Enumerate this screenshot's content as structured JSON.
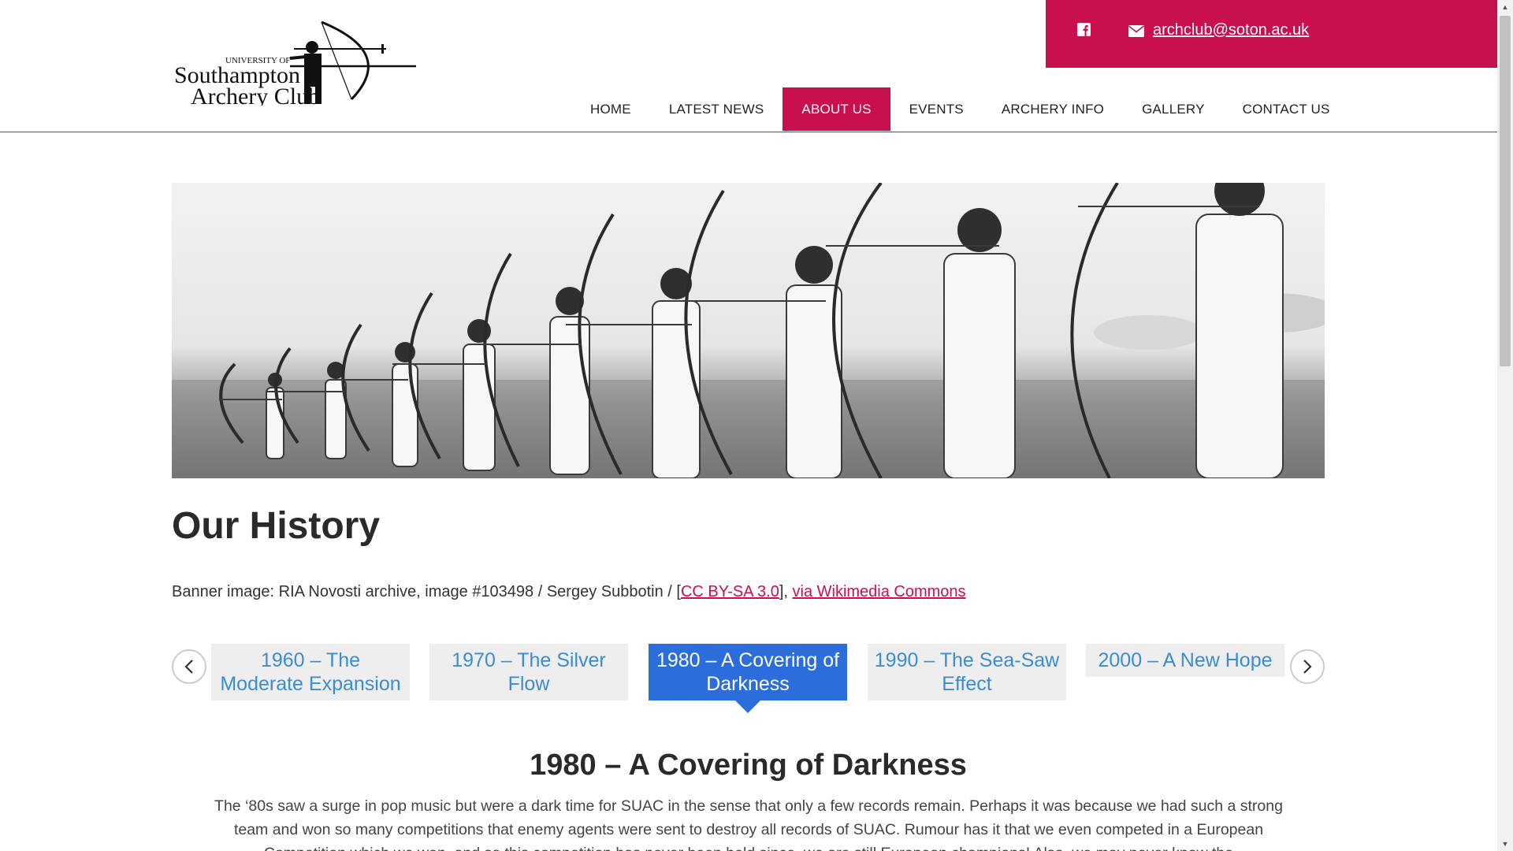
{
  "header": {
    "logo": {
      "line1": "UNIVERSITY OF",
      "line2": "Southampton",
      "line3": "Archery Club"
    },
    "contact": {
      "facebook_icon": "facebook-icon",
      "mail_icon": "envelope-icon",
      "email": "archclub@soton.ac.uk"
    },
    "nav": [
      {
        "label": "HOME",
        "active": false
      },
      {
        "label": "LATEST NEWS",
        "active": false
      },
      {
        "label": "ABOUT US",
        "active": true
      },
      {
        "label": "EVENTS",
        "active": false
      },
      {
        "label": "ARCHERY INFO",
        "active": false
      },
      {
        "label": "GALLERY",
        "active": false
      },
      {
        "label": "CONTACT US",
        "active": false
      }
    ]
  },
  "page": {
    "title": "Our History",
    "credit_prefix": "Banner image: RIA Novosti archive, image #103498 / Sergey Subbotin / [",
    "credit_link1": "CC BY-SA 3.0",
    "credit_mid": "], ",
    "credit_link2": "via Wikimedia Commons"
  },
  "timeline": {
    "items": [
      {
        "label": "1960 – The Moderate Expansion",
        "active": false
      },
      {
        "label": "1970 – The Silver Flow",
        "active": false
      },
      {
        "label": "1980 – A Covering of Darkness",
        "active": true
      },
      {
        "label": "1990 – The Sea-Saw Effect",
        "active": false
      },
      {
        "label": "2000 – A New Hope",
        "active": false
      }
    ],
    "prev_icon": "chevron-left-icon",
    "next_icon": "chevron-right-icon"
  },
  "era": {
    "title": "1980 – A Covering of Darkness",
    "body": "The ‘80s saw a surge in pop music but were a dark time for SUAC in the sense that only a few records remain. Perhaps it was because we had such a strong team and won so many competitions that enemy agents were sent to destroy all records of SUAC. Rumour has it that we even competed in a European Competition which we won, and so this competition has never been held since, we are still European champions! Also, we may never know the"
  },
  "colors": {
    "brand": "#c8104e",
    "timeline_active": "#2a6ddb",
    "timeline_text": "#3a8dd4"
  }
}
